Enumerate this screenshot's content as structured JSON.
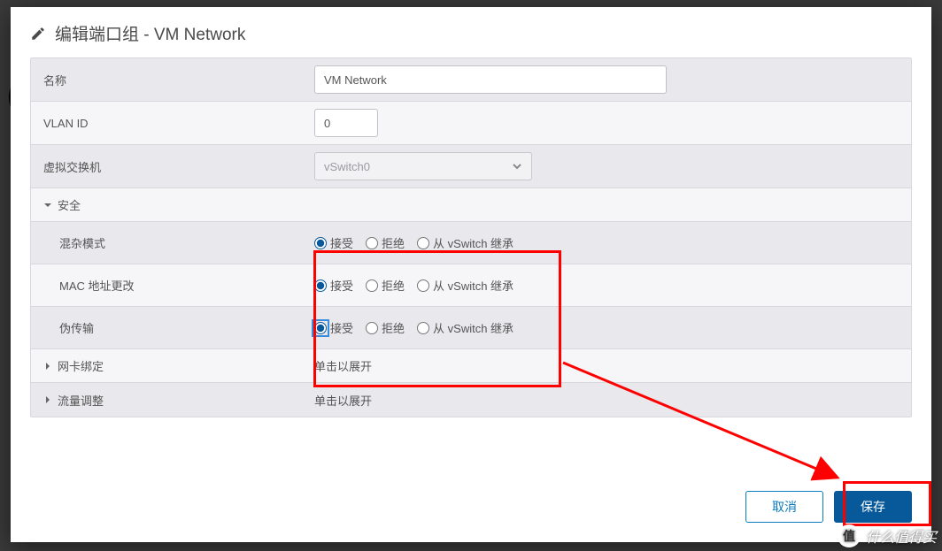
{
  "dialog": {
    "title": "编辑端口组 - VM Network"
  },
  "form": {
    "name_label": "名称",
    "name_value": "VM Network",
    "vlan_label": "VLAN ID",
    "vlan_value": "0",
    "vswitch_label": "虚拟交换机",
    "vswitch_value": "vSwitch0",
    "security_label": "安全",
    "options": {
      "accept": "接受",
      "reject": "拒绝",
      "inherit": "从 vSwitch 继承"
    },
    "promisc_label": "混杂模式",
    "mac_label": "MAC 地址更改",
    "forged_label": "伪传输",
    "nic_label": "网卡绑定",
    "traffic_label": "流量调整",
    "expand_hint": "单击以展开"
  },
  "footer": {
    "cancel": "取消",
    "save": "保存"
  },
  "watermark": "什么值得买"
}
